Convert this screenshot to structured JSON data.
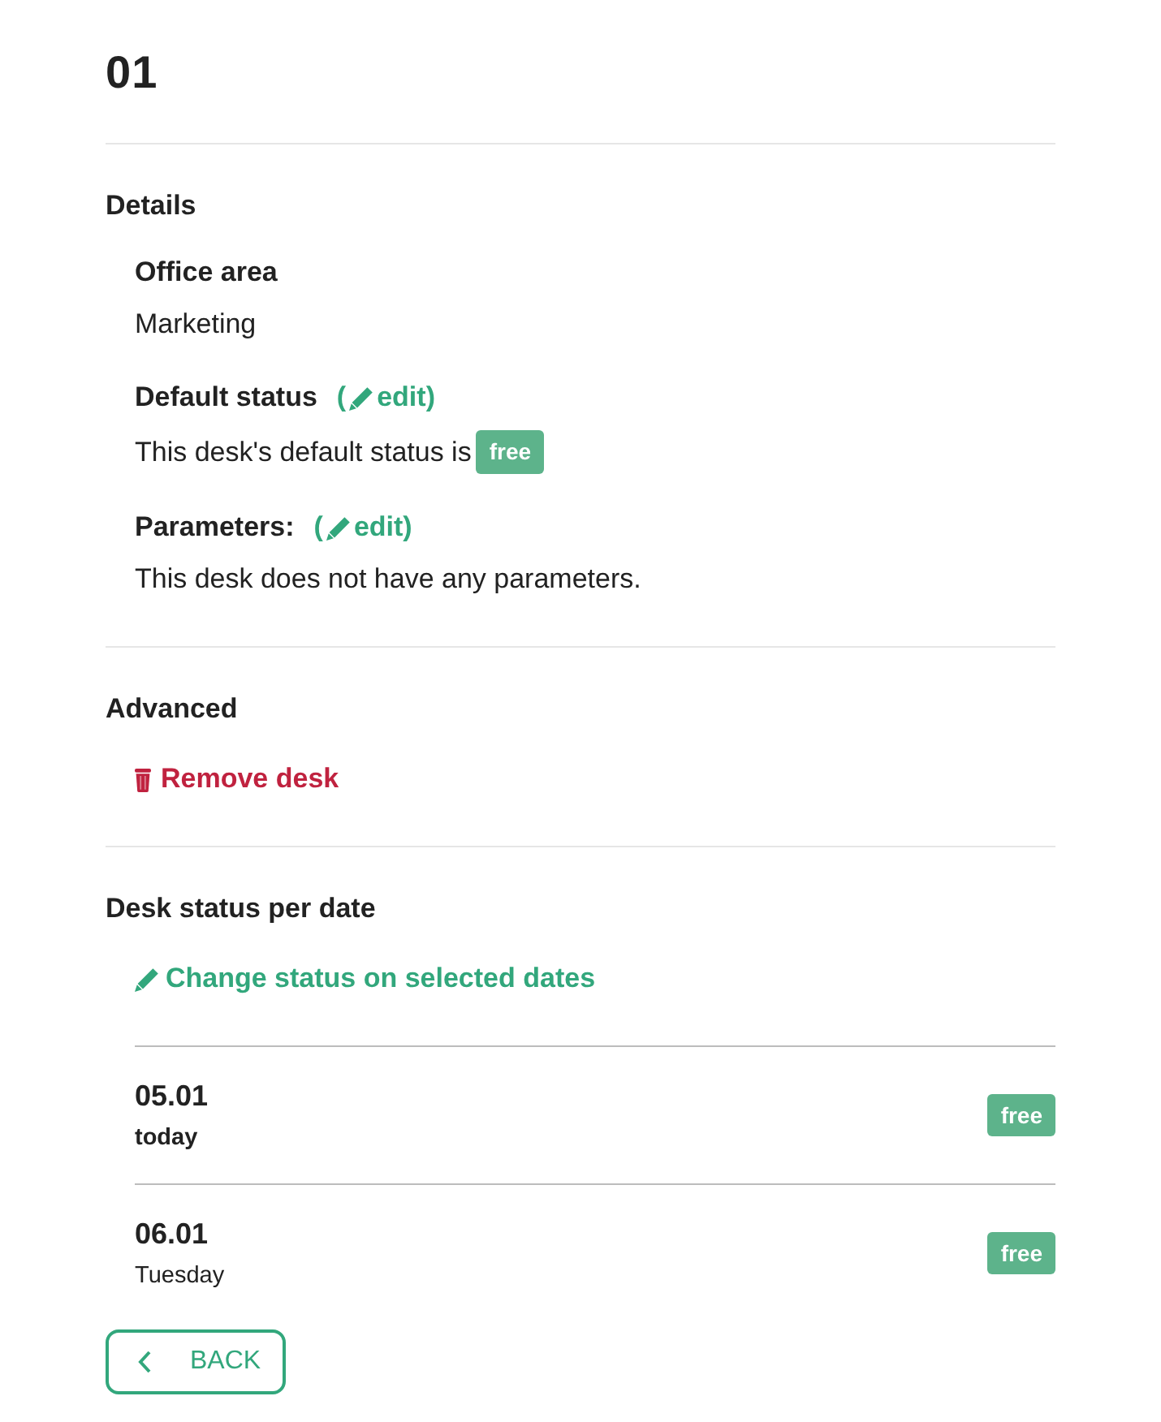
{
  "title": "01",
  "sections": [
    {
      "heading": "Details",
      "fields": [
        {
          "label": "Office area",
          "value": "Marketing"
        },
        {
          "label": "Default status",
          "edit_link": {
            "prefix": "(",
            "label": "edit)"
          },
          "text": "This desk's default status is",
          "badge": "free"
        },
        {
          "label": "Parameters:",
          "edit_link": {
            "prefix": "(",
            "label": "edit)"
          },
          "text": "This desk does not have any parameters."
        }
      ]
    },
    {
      "heading": "Advanced",
      "action": {
        "kind": "remove",
        "label": "Remove desk"
      }
    },
    {
      "heading": "Desk status per date",
      "action": {
        "kind": "edit",
        "label": "Change status on selected dates"
      },
      "dates": [
        {
          "date": "05.01",
          "day": "today",
          "today": true,
          "status": "free"
        },
        {
          "date": "06.01",
          "day": "Tuesday",
          "today": false,
          "status": "free"
        }
      ]
    }
  ],
  "back_button": {
    "label": "BACK"
  }
}
